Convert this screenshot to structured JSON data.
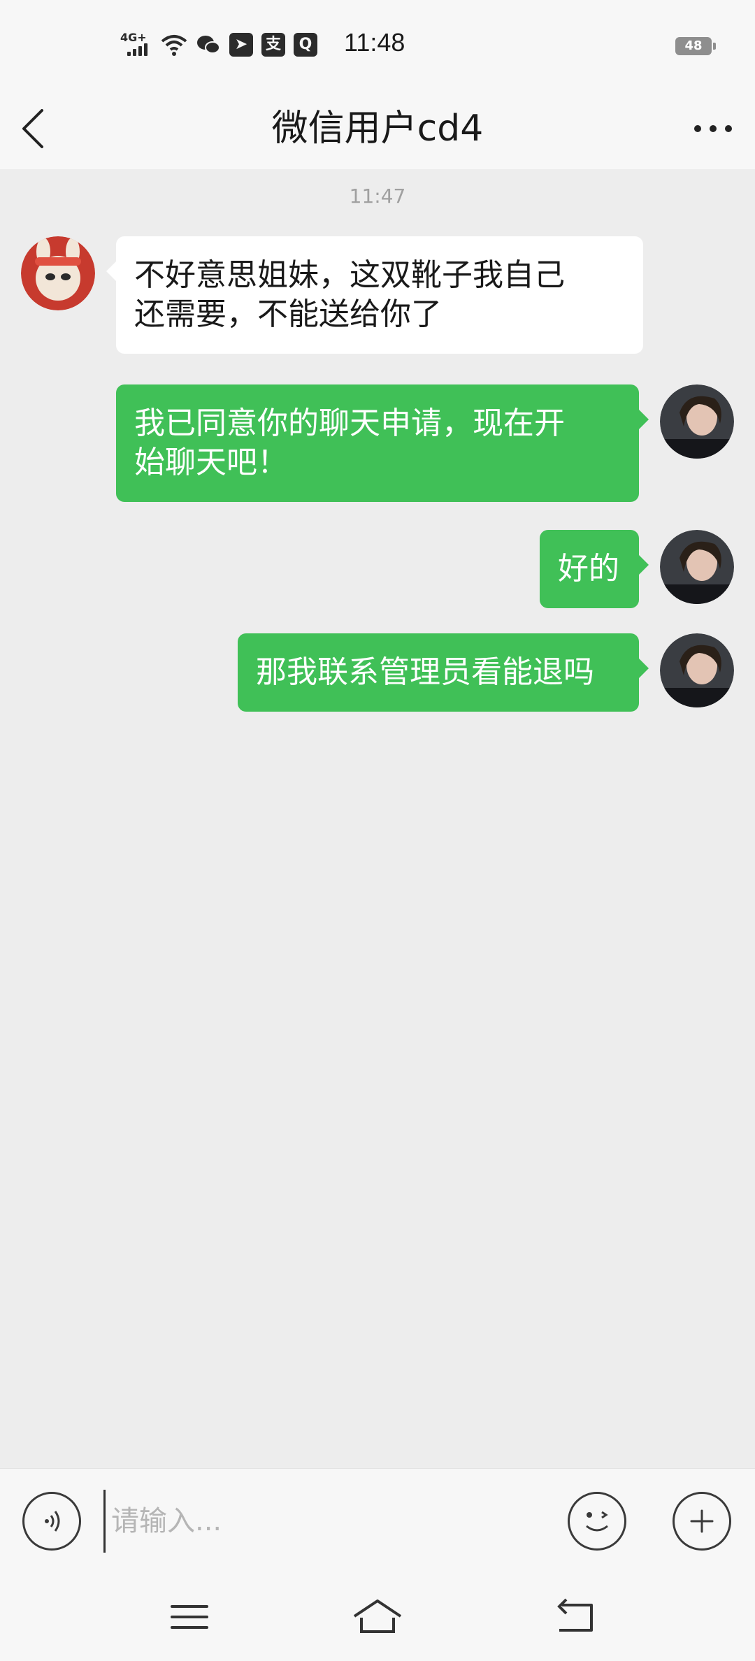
{
  "status_bar": {
    "network": "4G+",
    "time": "11:48",
    "battery": "48",
    "app_icons": [
      "wechat-icon",
      "send-icon",
      "alipay-icon",
      "search-app-icon"
    ]
  },
  "header": {
    "title": "微信用户cd4"
  },
  "chat": {
    "timestamp": "11:47",
    "messages": [
      {
        "direction": "in",
        "text_line1": "不好意思姐妹，这双靴子我自己",
        "text_line2": "还需要，不能送给你了"
      },
      {
        "direction": "out",
        "text_line1": "我已同意你的聊天申请，现在开",
        "text_line2": "始聊天吧！"
      },
      {
        "direction": "out",
        "text_line1": "好的"
      },
      {
        "direction": "out",
        "text_line1": "那我联系管理员看能退吗"
      }
    ]
  },
  "input": {
    "placeholder": "请输入..."
  },
  "colors": {
    "outgoing_bubble": "#40c057",
    "incoming_bubble": "#ffffff",
    "background": "#ededed"
  }
}
